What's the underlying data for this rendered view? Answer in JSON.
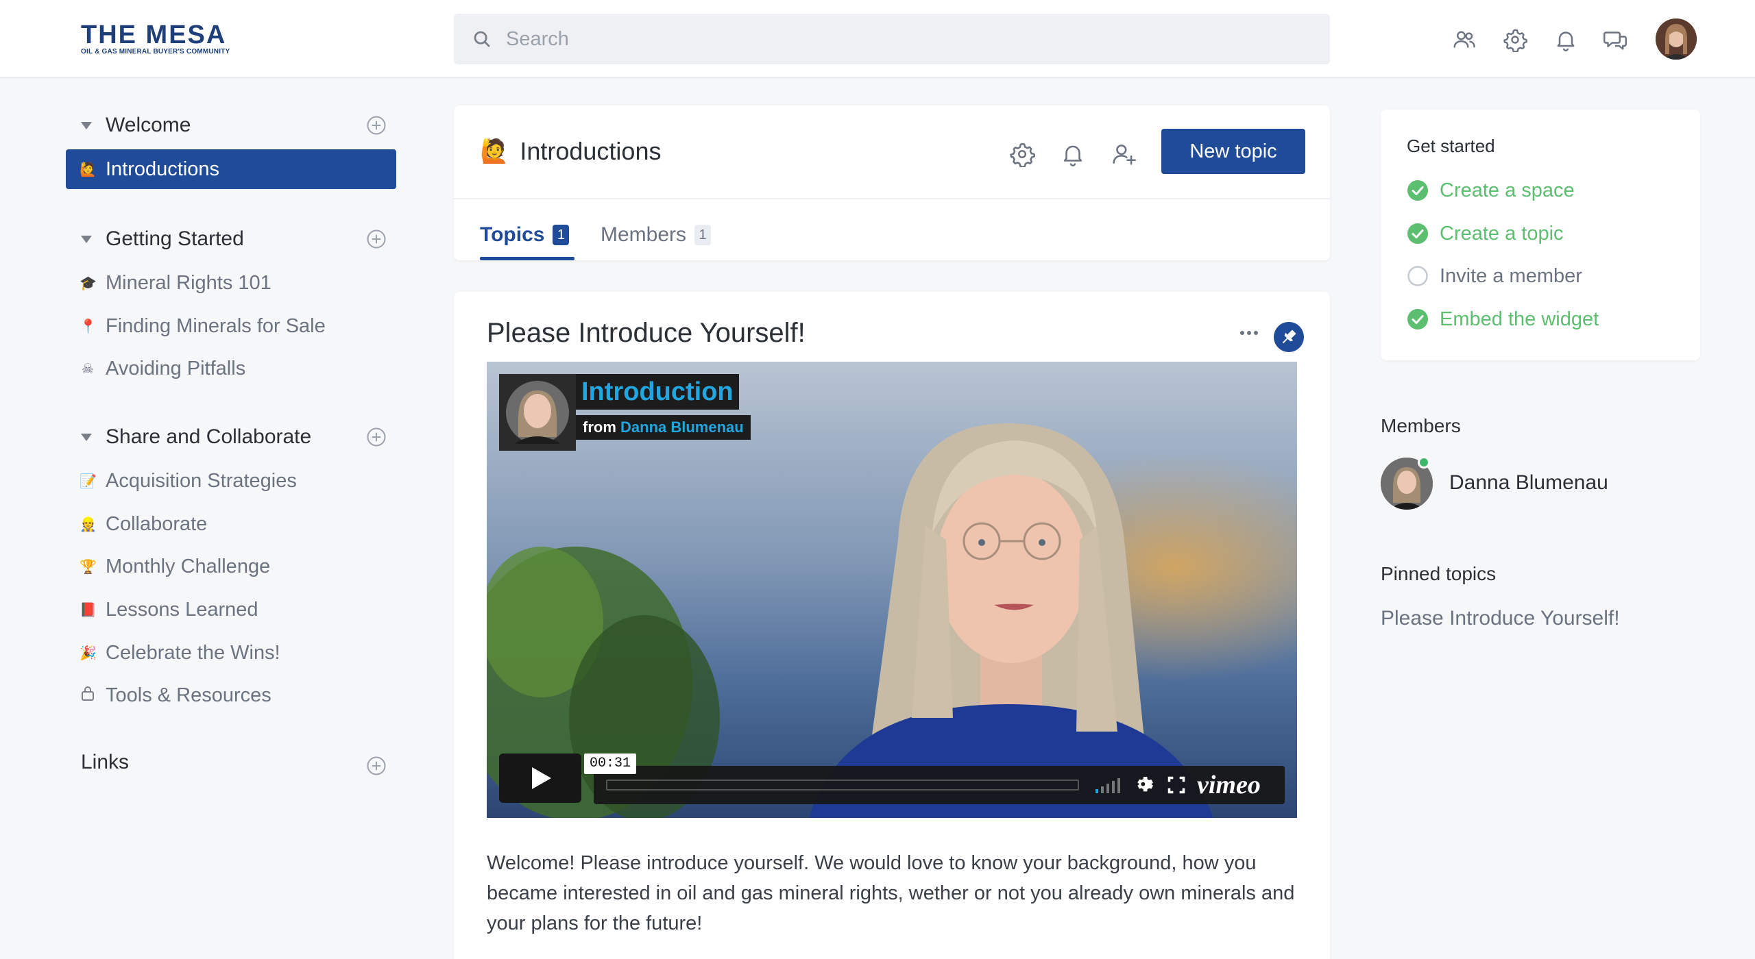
{
  "brand": {
    "name": "THE MESA",
    "tagline": "OIL & GAS MINERAL BUYER'S COMMUNITY",
    "color": "#1f3f7a"
  },
  "search": {
    "placeholder": "Search",
    "value": ""
  },
  "header_icons": [
    "members-icon",
    "gear-icon",
    "bell-icon",
    "chat-icon",
    "avatar"
  ],
  "sidebar": {
    "sections": [
      {
        "title": "Welcome",
        "items": [
          {
            "label": "Introductions",
            "emoji": "🙋",
            "active": true
          }
        ]
      },
      {
        "title": "Getting Started",
        "items": [
          {
            "label": "Mineral Rights 101",
            "emoji": "🎓"
          },
          {
            "label": "Finding Minerals for Sale",
            "emoji": "📍"
          },
          {
            "label": "Avoiding Pitfalls",
            "emoji": "☠"
          }
        ]
      },
      {
        "title": "Share and Collaborate",
        "items": [
          {
            "label": "Acquisition Strategies",
            "emoji": "📝"
          },
          {
            "label": "Collaborate",
            "emoji": "👷"
          },
          {
            "label": "Monthly Challenge",
            "emoji": "🏆"
          },
          {
            "label": "Lessons Learned",
            "emoji": "📕"
          },
          {
            "label": "Celebrate the Wins!",
            "emoji": "🎉"
          },
          {
            "label": "Tools & Resources",
            "emoji": "lock-icon"
          }
        ]
      }
    ],
    "links_title": "Links"
  },
  "space": {
    "emoji": "🙋",
    "title": "Introductions",
    "new_topic_label": "New topic",
    "tabs": [
      {
        "label": "Topics",
        "count": "1",
        "active": true
      },
      {
        "label": "Members",
        "count": "1",
        "active": false
      }
    ]
  },
  "post": {
    "title": "Please Introduce Yourself!",
    "video": {
      "title": "Introduction",
      "from_prefix": "from",
      "author": "Danna Blumenau",
      "time": "00:31",
      "provider": "vimeo"
    },
    "body": "Welcome!  Please introduce yourself.  We would love to know your background, how you became interested in oil and gas mineral rights, wether or not you already own minerals and your plans for the future!"
  },
  "get_started": {
    "title": "Get started",
    "items": [
      {
        "label": "Create a space",
        "done": true
      },
      {
        "label": "Create a topic",
        "done": true
      },
      {
        "label": "Invite a member",
        "done": false
      },
      {
        "label": "Embed the widget",
        "done": true
      }
    ]
  },
  "members": {
    "title": "Members",
    "list": [
      {
        "name": "Danna Blumenau",
        "online": true
      }
    ]
  },
  "pinned": {
    "title": "Pinned topics",
    "items": [
      "Please Introduce Yourself!"
    ]
  },
  "colors": {
    "accent": "#1f4b99",
    "success": "#5cbf70",
    "muted": "#6b7280",
    "background": "#f6f7f9"
  }
}
